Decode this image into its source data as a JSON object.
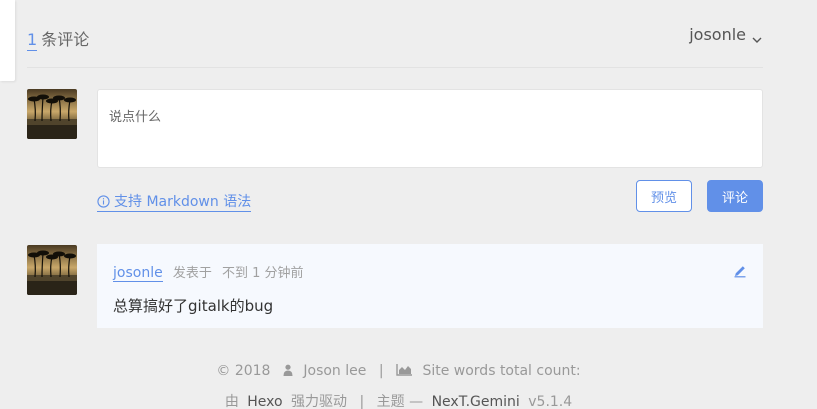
{
  "header": {
    "comment_count": "1",
    "comment_count_label": "条评论",
    "username": "josonle",
    "chevron_icon": "chevron-down-icon"
  },
  "editor": {
    "placeholder": "说点什么",
    "value": "",
    "markdown_tip": "支持 Markdown 语法",
    "preview_label": "预览",
    "submit_label": "评论",
    "accent_color": "#6190e8"
  },
  "comments": [
    {
      "author": "josonle",
      "posted_label": "发表于",
      "time": "不到 1 分钟前",
      "body": "总算搞好了gitalk的bug",
      "edit_icon": "pencil-icon"
    }
  ],
  "footer": {
    "copyright": "© 2018",
    "author_name": "Joson lee",
    "words_label": "Site words total count:",
    "powered_prefix": "由",
    "powered_link": "Hexo",
    "powered_suffix": "强力驱动",
    "theme_prefix": "主题 —",
    "theme_link": "NexT.Gemini",
    "theme_version": "v5.1.4",
    "separator": "|"
  }
}
